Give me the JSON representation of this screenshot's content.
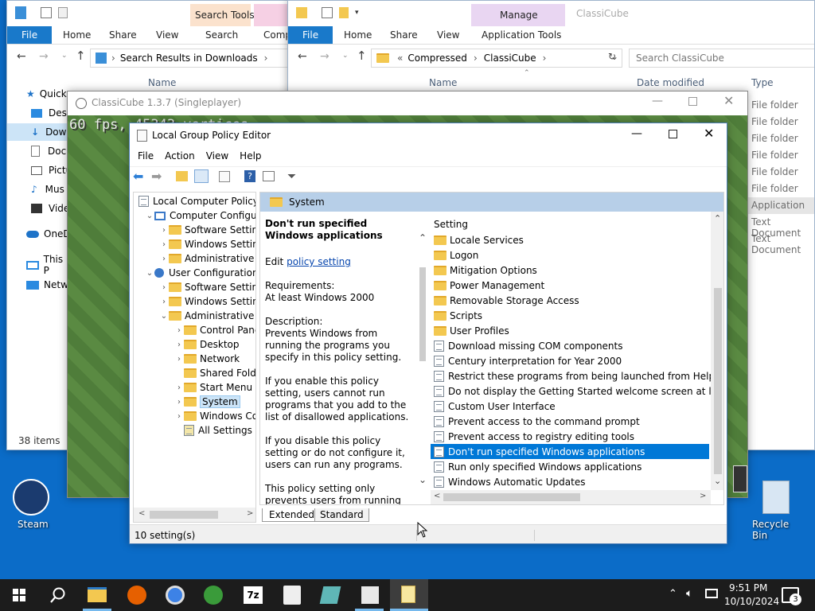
{
  "explorer_left": {
    "tool_tab": "Search Tools",
    "ribbon_tabs": [
      "File",
      "Home",
      "Share",
      "View",
      "Search",
      "Comp"
    ],
    "address": "Search Results in Downloads",
    "column_name": "Name",
    "nav_items": [
      "Quick",
      "Desk",
      "Dow",
      "Docu",
      "Pictu",
      "Mus",
      "Vide",
      "OneD",
      "This P",
      "Netwo"
    ],
    "status": "38 items"
  },
  "explorer_right": {
    "tool_tab": "Manage",
    "window_title": "ClassiCube",
    "ribbon_tabs": [
      "File",
      "Home",
      "Share",
      "View",
      "Application Tools"
    ],
    "address_prefix": "«",
    "address_parts": [
      "Compressed",
      "ClassiCube"
    ],
    "search_placeholder": "Search ClassiCube",
    "col_name": "Name",
    "col_date": "Date modified",
    "col_type": "Type",
    "types": [
      "File folder",
      "File folder",
      "File folder",
      "File folder",
      "File folder",
      "File folder",
      "Application",
      "Text Document",
      "Text Document"
    ]
  },
  "classicube": {
    "title": "ClassiCube 1.3.7 (Singleplayer)",
    "overlay_text": "60 fps, 45343 vertices"
  },
  "gpedit": {
    "title": "Local Group Policy Editor",
    "menu": [
      "File",
      "Action",
      "View",
      "Help"
    ],
    "tree": [
      {
        "label": "Local Computer Policy",
        "level": 0,
        "exp": "",
        "type": "root"
      },
      {
        "label": "Computer Configura",
        "level": 1,
        "exp": "v",
        "type": "comp"
      },
      {
        "label": "Software Settings",
        "level": 2,
        "exp": ">",
        "type": "folder"
      },
      {
        "label": "Windows Setting",
        "level": 2,
        "exp": ">",
        "type": "folder"
      },
      {
        "label": "Administrative Te",
        "level": 2,
        "exp": ">",
        "type": "folder"
      },
      {
        "label": "User Configuration",
        "level": 1,
        "exp": "v",
        "type": "user"
      },
      {
        "label": "Software Settings",
        "level": 2,
        "exp": ">",
        "type": "folder"
      },
      {
        "label": "Windows Setting",
        "level": 2,
        "exp": ">",
        "type": "folder"
      },
      {
        "label": "Administrative Te",
        "level": 2,
        "exp": "v",
        "type": "folder"
      },
      {
        "label": "Control Panel",
        "level": 3,
        "exp": ">",
        "type": "folder"
      },
      {
        "label": "Desktop",
        "level": 3,
        "exp": ">",
        "type": "folder"
      },
      {
        "label": "Network",
        "level": 3,
        "exp": ">",
        "type": "folder"
      },
      {
        "label": "Shared Folder",
        "level": 3,
        "exp": "",
        "type": "folder"
      },
      {
        "label": "Start Menu ar",
        "level": 3,
        "exp": ">",
        "type": "folder"
      },
      {
        "label": "System",
        "level": 3,
        "exp": ">",
        "type": "folder",
        "selected": true
      },
      {
        "label": "Windows Cor",
        "level": 3,
        "exp": ">",
        "type": "folder"
      },
      {
        "label": "All Settings",
        "level": 3,
        "exp": "",
        "type": "allsettings"
      }
    ],
    "header": "System",
    "desc_title": "Don't run specified Windows applications",
    "edit_prefix": "Edit",
    "edit_link": "policy setting",
    "requirements_label": "Requirements:",
    "requirements": "At least Windows 2000",
    "description_label": "Description:",
    "desc_p1": "Prevents Windows from running the programs you specify in this policy setting.",
    "desc_p2": "If you enable this policy setting, users cannot run programs that you add to the list of disallowed applications.",
    "desc_p3": "If you disable this policy setting or do not configure it, users can run any programs.",
    "desc_p4": "This policy setting only prevents users from running programs that",
    "list_header": "Setting",
    "items": [
      {
        "label": "Locale Services",
        "type": "folder"
      },
      {
        "label": "Logon",
        "type": "folder"
      },
      {
        "label": "Mitigation Options",
        "type": "folder"
      },
      {
        "label": "Power Management",
        "type": "folder"
      },
      {
        "label": "Removable Storage Access",
        "type": "folder"
      },
      {
        "label": "Scripts",
        "type": "folder"
      },
      {
        "label": "User Profiles",
        "type": "folder"
      },
      {
        "label": "Download missing COM components",
        "type": "setting"
      },
      {
        "label": "Century interpretation for Year 2000",
        "type": "setting"
      },
      {
        "label": "Restrict these programs from being launched from Help",
        "type": "setting"
      },
      {
        "label": "Do not display the Getting Started welcome screen at logon",
        "type": "setting"
      },
      {
        "label": "Custom User Interface",
        "type": "setting"
      },
      {
        "label": "Prevent access to the command prompt",
        "type": "setting"
      },
      {
        "label": "Prevent access to registry editing tools",
        "type": "setting"
      },
      {
        "label": "Don't run specified Windows applications",
        "type": "setting",
        "selected": true
      },
      {
        "label": "Run only specified Windows applications",
        "type": "setting"
      },
      {
        "label": "Windows Automatic Updates",
        "type": "setting"
      }
    ],
    "tabs": [
      "Extended",
      "Standard"
    ],
    "status": "10 setting(s)"
  },
  "desktop": {
    "steam_label": "Steam",
    "recycle_label": "Recycle Bin"
  },
  "taskbar": {
    "time": "9:51 PM",
    "date": "10/10/2024",
    "notifications": "3"
  },
  "colors": {
    "accent": "#0078d7",
    "selection": "#0078d7",
    "header_bar": "#b7cfe8"
  }
}
